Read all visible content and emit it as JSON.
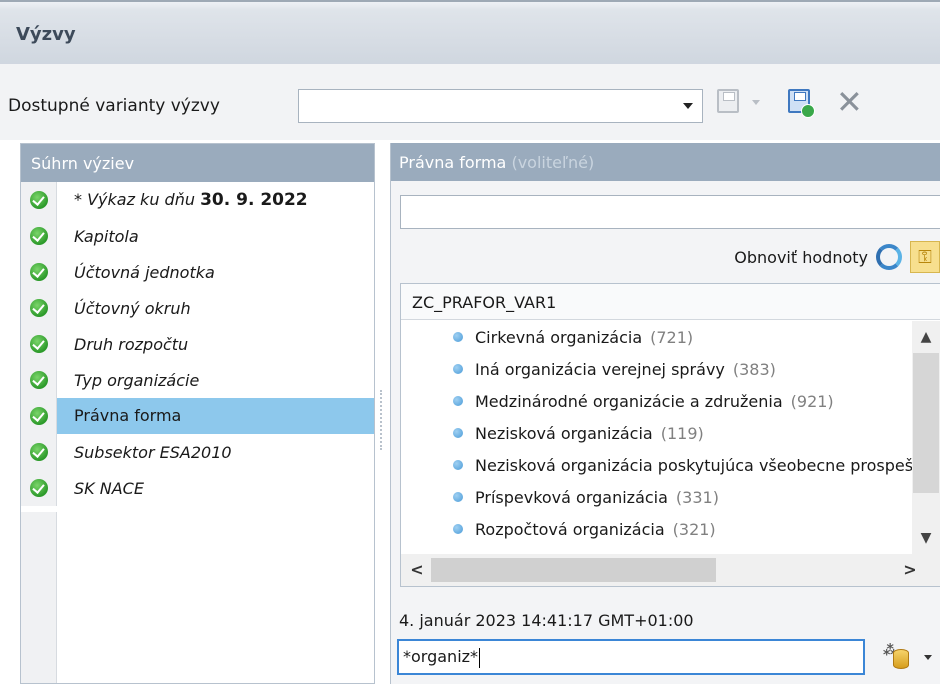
{
  "window": {
    "title": "Výzvy"
  },
  "variants": {
    "label": "Dostupné varianty výzvy",
    "value": ""
  },
  "summary": {
    "header": "Súhrn výziev",
    "items": [
      {
        "prefix": "* Výkaz ku dňu",
        "bold": "30. 9. 2022"
      },
      {
        "label": "Kapitola"
      },
      {
        "label": "Účtovná jednotka"
      },
      {
        "label": "Účtovný okruh"
      },
      {
        "label": "Druh rozpočtu"
      },
      {
        "label": "Typ organizácie"
      },
      {
        "label": "Právna forma",
        "selected": true
      },
      {
        "label": "Subsektor ESA2010"
      },
      {
        "label": "SK NACE"
      }
    ]
  },
  "detail": {
    "header": "Právna forma",
    "header_optional": "(voliteľné)",
    "filter_value": "",
    "refresh_label": "Obnoviť hodnoty",
    "list_header": "ZC_PRAFOR_VAR1",
    "items": [
      {
        "label": "Cirkevná organizácia",
        "count": "(721)"
      },
      {
        "label": "Iná organizácia verejnej správy",
        "count": "(383)"
      },
      {
        "label": "Medzinárodné organizácie a združenia",
        "count": "(921)"
      },
      {
        "label": "Nezisková organizácia",
        "count": "(119)"
      },
      {
        "label": "Nezisková organizácia poskytujúca všeobecne prospešné služby",
        "count": ""
      },
      {
        "label": "Príspevková organizácia",
        "count": "(331)"
      },
      {
        "label": "Rozpočtová organizácia",
        "count": "(321)"
      }
    ],
    "timestamp": "4. január 2023 14:41:17 GMT+01:00",
    "search_value": "*organiz*"
  },
  "colors": {
    "selected_row": "#8dc8ec",
    "panel_header": "#9aabbd",
    "search_border": "#3b86d6"
  }
}
